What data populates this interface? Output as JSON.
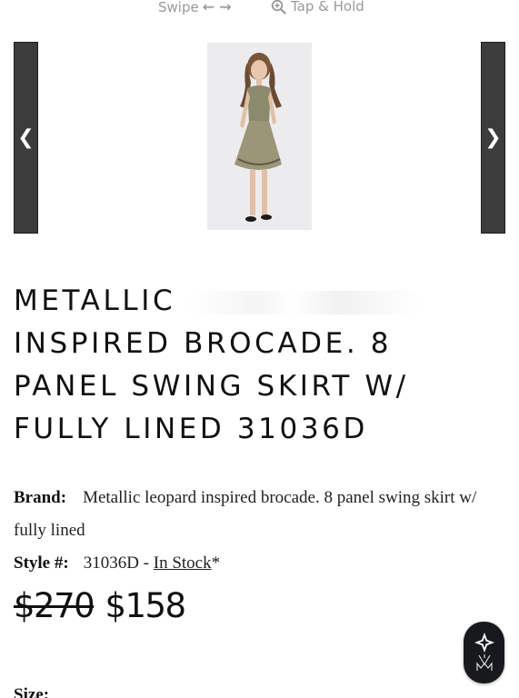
{
  "hints": {
    "swipe_label": "Swipe",
    "swipe_arrows": "⇜ ⇝",
    "tap_label": "Tap & Hold"
  },
  "gallery": {
    "prev_glyph": "❮",
    "next_glyph": "❯"
  },
  "product": {
    "title_line1": "METALLIC",
    "title_rest": "INSPIRED BROCADE. 8 PANEL SWING SKIRT W/ FULLY LINED 31036D",
    "brand_label": "Brand:",
    "brand_value": "Metallic leopard inspired brocade. 8 panel swing skirt w/ fully lined",
    "style_label": "Style #:",
    "style_value": "31036D - ",
    "stock_label": "In Stock",
    "stock_mark": "*",
    "price_old": "$270",
    "price_new": "$158",
    "size_label": "Size:"
  },
  "colors": {
    "nav_bg": "#3c3c3c",
    "fab_bg": "#17191d",
    "hint_text": "#9a9a9a"
  },
  "icons": [
    "zoom-icon",
    "chevron-left-icon",
    "chevron-right-icon",
    "brand-logo-icon"
  ]
}
